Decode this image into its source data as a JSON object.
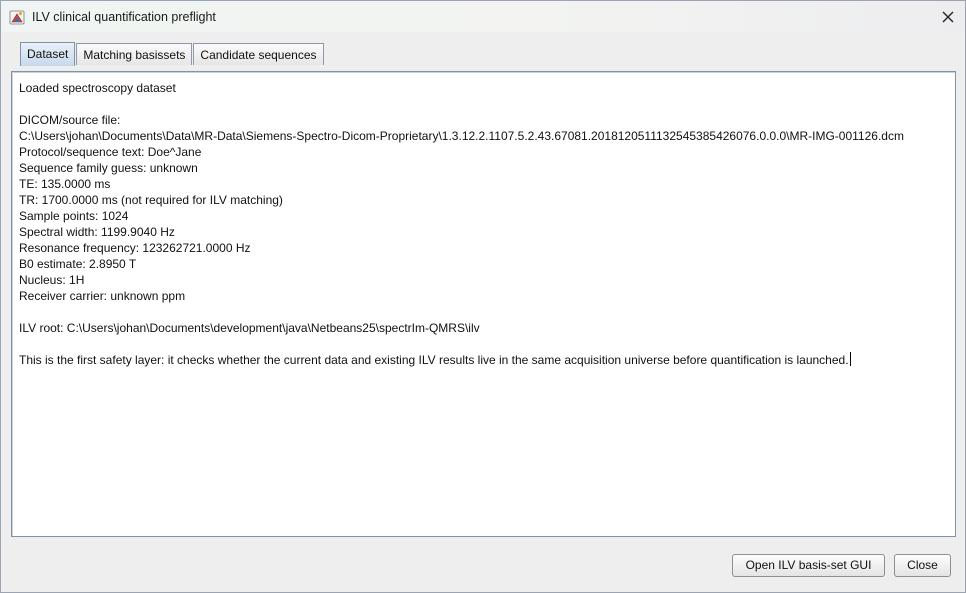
{
  "window": {
    "title": "ILV clinical quantification preflight",
    "icon": "java-app-icon",
    "close_icon": "close-icon"
  },
  "tabs": [
    {
      "label": "Dataset",
      "selected": true
    },
    {
      "label": "Matching basissets",
      "selected": false
    },
    {
      "label": "Candidate sequences",
      "selected": false
    }
  ],
  "dataset": {
    "heading": "Loaded spectroscopy dataset",
    "source_label": "DICOM/source file:",
    "source_path": "C:\\Users\\johan\\Documents\\Data\\MR-Data\\Siemens-Spectro-Dicom-Proprietary\\1.3.12.2.1107.5.2.43.67081.2018120511132545385426076.0.0.0\\MR-IMG-001126.dcm",
    "protocol": "Protocol/sequence text: Doe^Jane",
    "sequence_family": "Sequence family guess: unknown",
    "te": "TE: 135.0000 ms",
    "tr": "TR: 1700.0000 ms (not required for ILV matching)",
    "sample_points": "Sample points: 1024",
    "spectral_width": "Spectral width: 1199.9040 Hz",
    "resonance_frequency": "Resonance frequency: 123262721.0000 Hz",
    "b0_estimate": "B0 estimate: 2.8950 T",
    "nucleus": "Nucleus: 1H",
    "receiver_carrier": "Receiver carrier: unknown ppm",
    "ilv_root": "ILV root: C:\\Users\\johan\\Documents\\development\\java\\Netbeans25\\spectrIm-QMRS\\ilv",
    "safety_note": "This is the first safety layer: it checks whether the current data and existing ILV results live in the same acquisition universe before quantification is launched."
  },
  "buttons": {
    "open_gui": "Open ILV basis-set GUI",
    "close": "Close"
  }
}
